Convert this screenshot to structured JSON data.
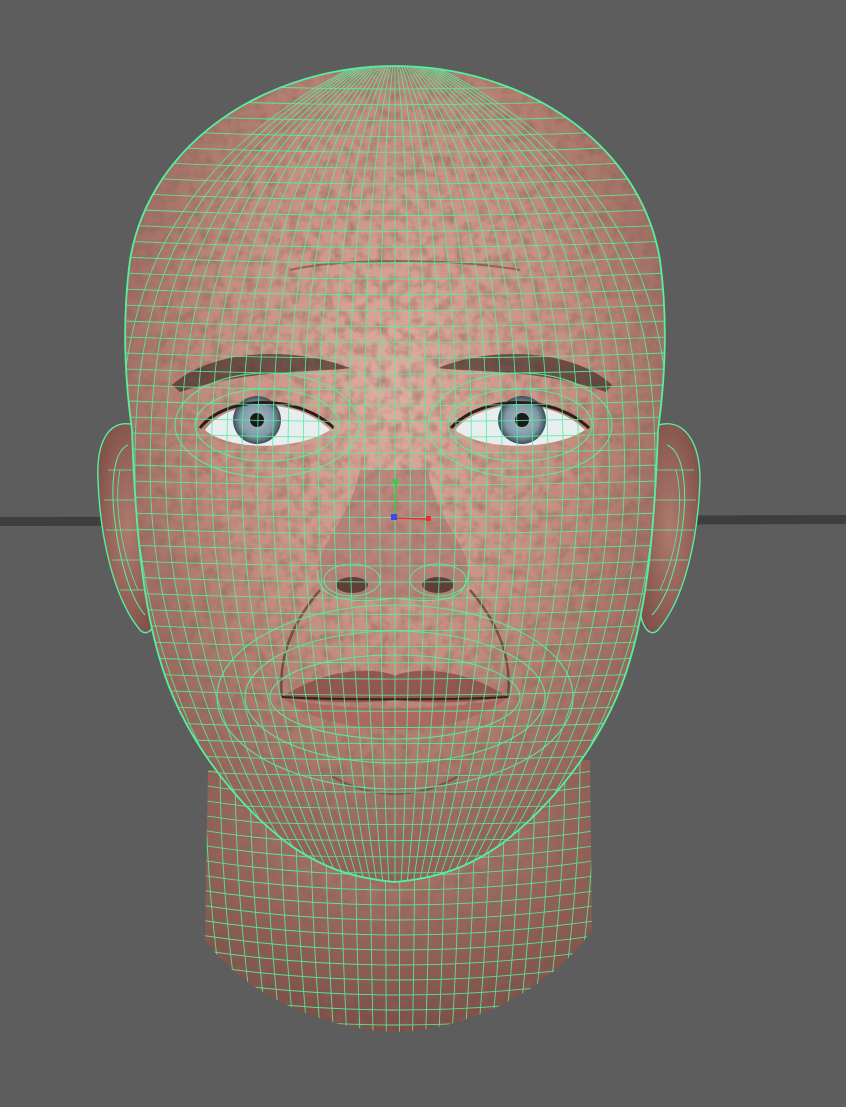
{
  "viewport": {
    "background_color": "#5d5d5d",
    "object": "head-mesh",
    "view": "front",
    "display_mode": "wireframe-on-shaded",
    "selected": true
  },
  "colors": {
    "wireframe": "#54f0a0",
    "skin": "#c58f80",
    "skin_light": "#e2b0a4",
    "skin_shadow": "#8a5a50",
    "iris": "#7f97a6",
    "pupil": "#1a1a1a",
    "sclera": "#e8eef0",
    "ground_grid": "#3e3e3e"
  },
  "manipulator": {
    "axes": [
      {
        "name": "x",
        "color": "#e83030"
      },
      {
        "name": "y",
        "color": "#30d040"
      },
      {
        "name": "z",
        "color": "#3050e8"
      }
    ]
  }
}
